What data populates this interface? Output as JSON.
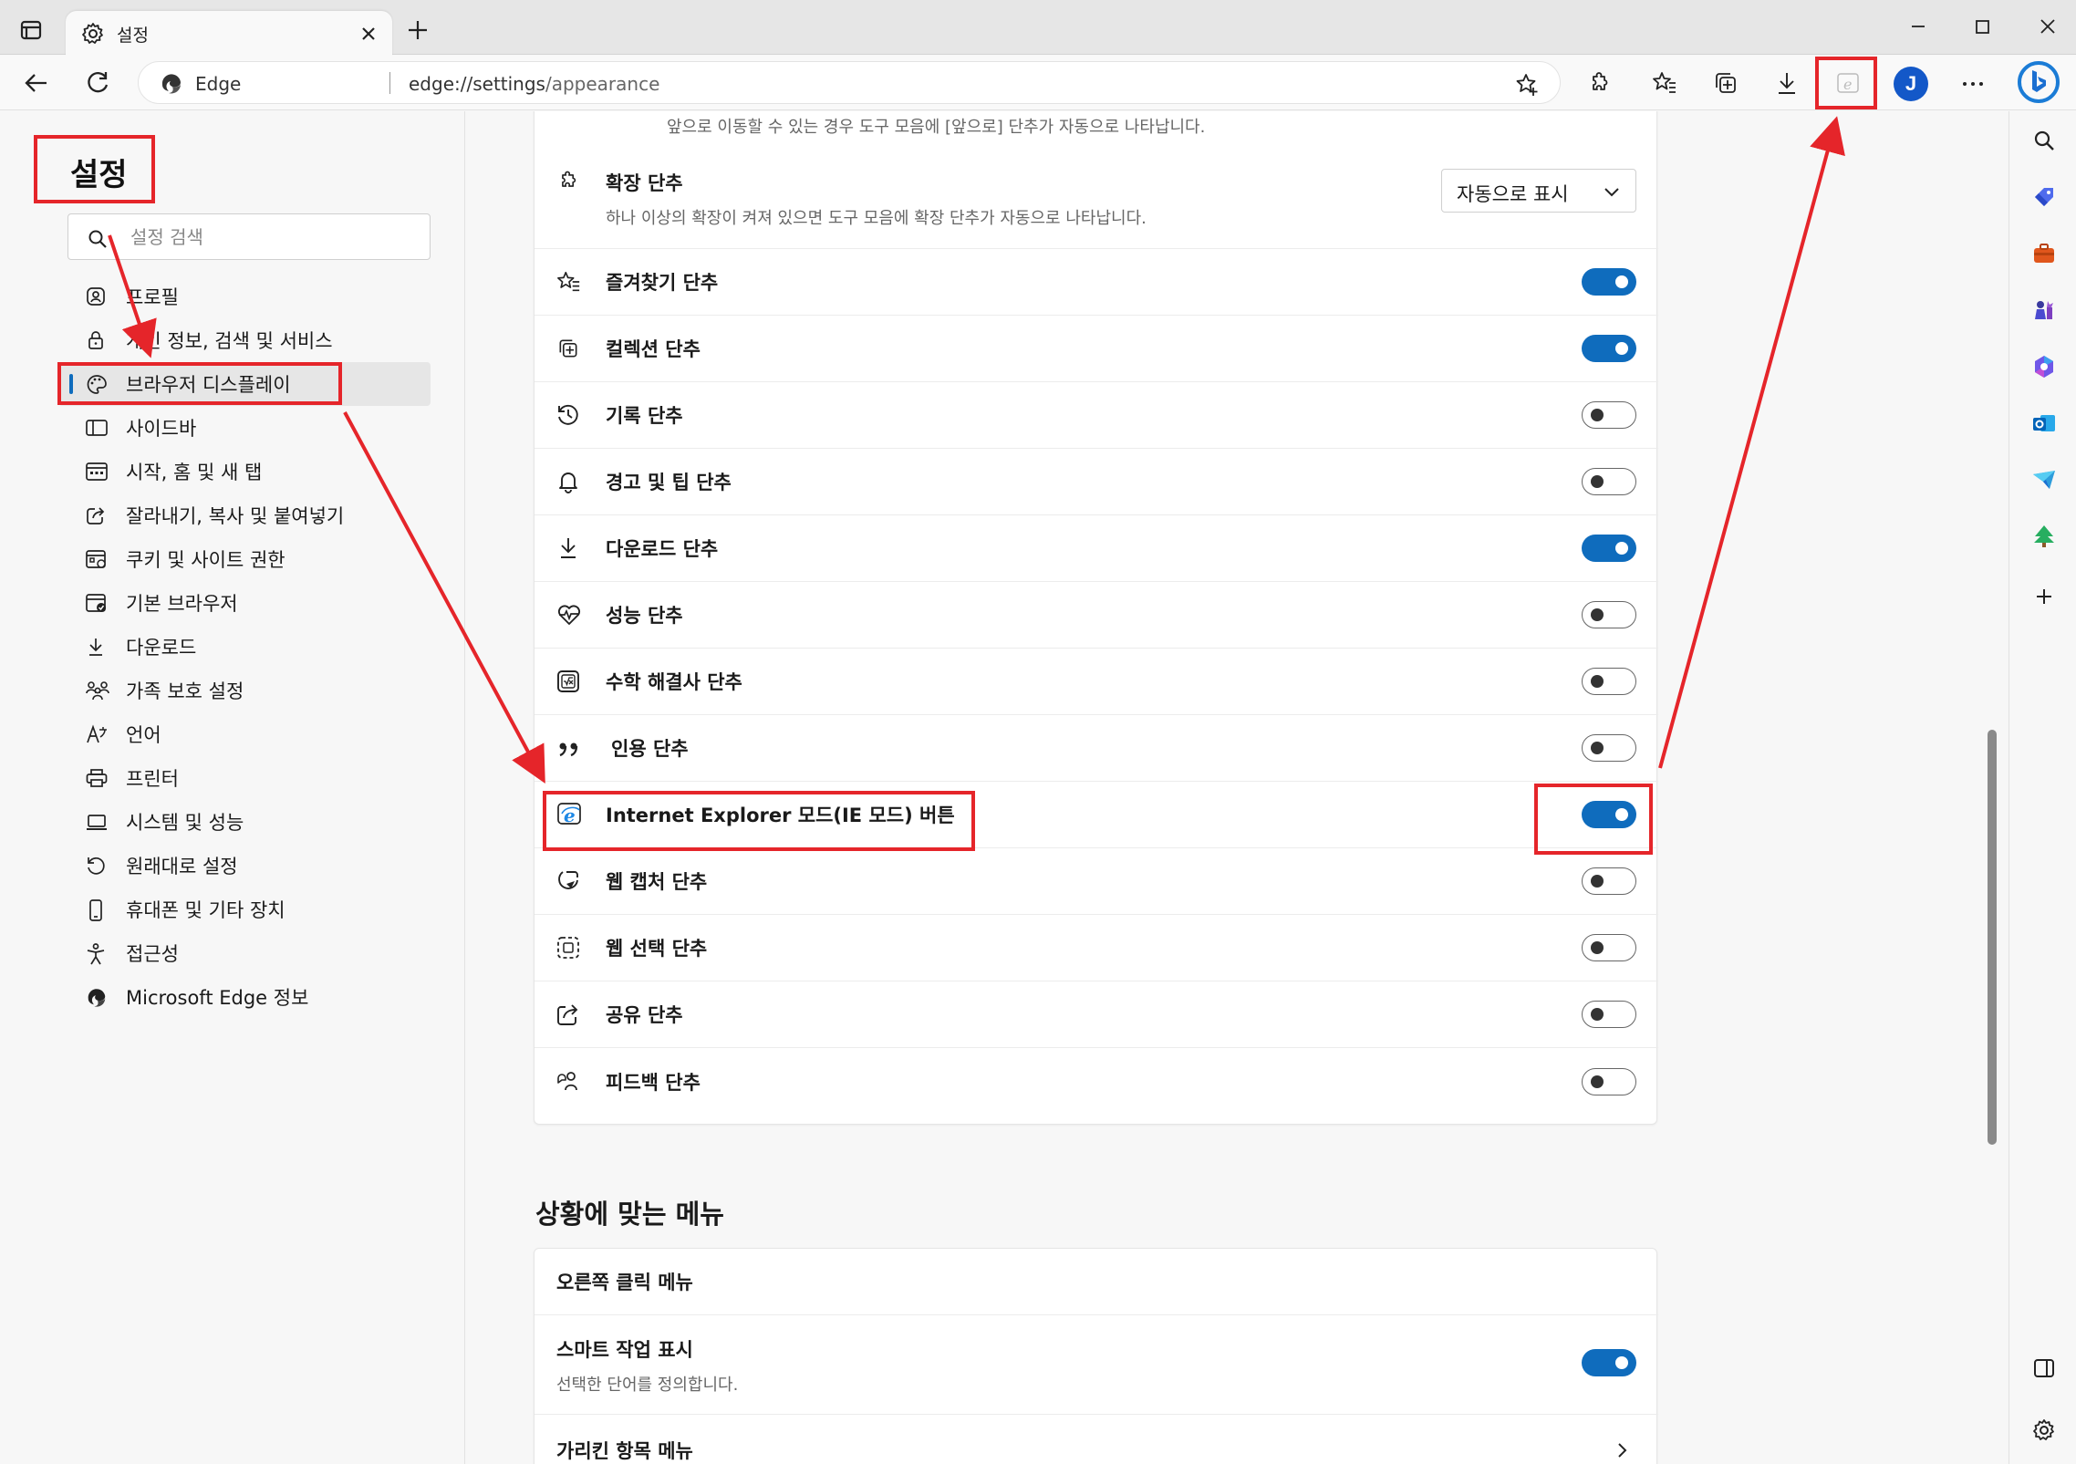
{
  "colors": {
    "accent": "#0f6cbd",
    "annotation": "#e5252a"
  },
  "tab": {
    "title": "설정",
    "icon": "gear-icon"
  },
  "address": {
    "site_label": "Edge",
    "url_host": "edge://settings",
    "url_path": "/appearance"
  },
  "profile": {
    "initial": "J"
  },
  "settings_title": "설정",
  "search": {
    "placeholder": "설정 검색"
  },
  "nav_items": [
    {
      "label": "프로필",
      "icon": "profile-icon"
    },
    {
      "label": "개인 정보, 검색 및 서비스",
      "icon": "lock-icon"
    },
    {
      "label": "브라우저 디스플레이",
      "icon": "palette-icon",
      "active": true
    },
    {
      "label": "사이드바",
      "icon": "sidebar-icon"
    },
    {
      "label": "시작, 홈 및 새 탭",
      "icon": "home-tab-icon"
    },
    {
      "label": "잘라내기, 복사 및 붙여넣기",
      "icon": "share-clipboard-icon"
    },
    {
      "label": "쿠키 및 사이트 권한",
      "icon": "cookie-permission-icon"
    },
    {
      "label": "기본 브라우저",
      "icon": "default-browser-icon"
    },
    {
      "label": "다운로드",
      "icon": "download-icon"
    },
    {
      "label": "가족 보호 설정",
      "icon": "family-icon"
    },
    {
      "label": "언어",
      "icon": "language-icon"
    },
    {
      "label": "프린터",
      "icon": "printer-icon"
    },
    {
      "label": "시스템 및 성능",
      "icon": "laptop-icon"
    },
    {
      "label": "원래대로 설정",
      "icon": "reset-icon"
    },
    {
      "label": "휴대폰 및 기타 장치",
      "icon": "phone-icon"
    },
    {
      "label": "접근성",
      "icon": "accessibility-icon"
    },
    {
      "label": "Microsoft Edge 정보",
      "icon": "edge-logo-icon"
    }
  ],
  "main": {
    "top_subtitle": "앞으로 이동할 수 있는 경우 도구 모음에 [앞으로] 단추가 자동으로 나타납니다.",
    "extension_row": {
      "title": "확장 단추",
      "subtitle": "하나 이상의 확장이 켜져 있으면 도구 모음에 확장 단추가 자동으로 나타납니다.",
      "dropdown_value": "자동으로 표시"
    },
    "toggle_rows": [
      {
        "title": "즐겨찾기 단추",
        "on": true,
        "icon": "favorites-icon"
      },
      {
        "title": "컬렉션 단추",
        "on": true,
        "icon": "collections-icon"
      },
      {
        "title": "기록 단추",
        "on": false,
        "icon": "history-icon"
      },
      {
        "title": "경고 및 팁 단추",
        "on": false,
        "icon": "bell-icon"
      },
      {
        "title": "다운로드 단추",
        "on": true,
        "icon": "download-icon"
      },
      {
        "title": "성능 단추",
        "on": false,
        "icon": "heartbeat-icon"
      },
      {
        "title": "수학 해결사 단추",
        "on": false,
        "icon": "math-solver-icon"
      },
      {
        "title": "인용 단추",
        "on": false,
        "icon": "quote-icon"
      },
      {
        "title": "Internet Explorer 모드(IE 모드) 버튼",
        "on": true,
        "icon": "ie-mode-icon"
      },
      {
        "title": "웹 캡처 단추",
        "on": false,
        "icon": "web-capture-icon"
      },
      {
        "title": "웹 선택 단추",
        "on": false,
        "icon": "web-select-icon"
      },
      {
        "title": "공유 단추",
        "on": false,
        "icon": "share-icon"
      },
      {
        "title": "피드백 단추",
        "on": false,
        "icon": "feedback-icon"
      }
    ],
    "context_menu_section": {
      "title": "상황에 맞는 메뉴",
      "rows": [
        {
          "title": "오른쪽 클릭 메뉴"
        },
        {
          "title": "스마트 작업 표시",
          "subtitle": "선택한 단어를 정의합니다.",
          "on": true
        },
        {
          "title": "가리킨 항목 메뉴"
        }
      ]
    }
  }
}
